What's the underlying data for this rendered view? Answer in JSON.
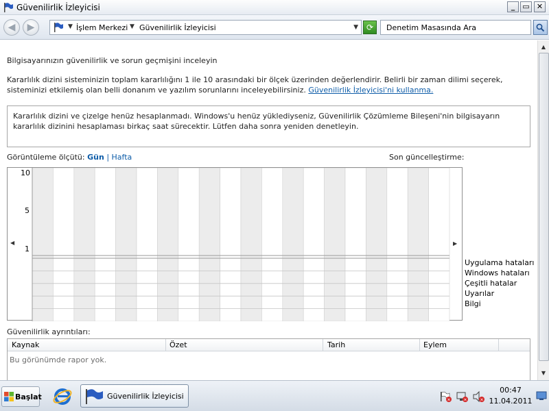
{
  "window": {
    "title": "Güvenilirlik İzleyicisi"
  },
  "nav": {
    "breadcrumbs": [
      "İşlem Merkezi",
      "Güvenilirlik İzleyicisi"
    ],
    "search_placeholder": "Denetim Masasında Ara"
  },
  "page": {
    "heading": "Bilgisayarınızın güvenilirlik ve sorun geçmişini inceleyin",
    "intro": "Kararlılık dizini sisteminizin toplam kararlılığını 1 ile 10 arasındaki bir ölçek üzerinden değerlendirir. Belirli bir zaman dilimi seçerek, sisteminizi etkilemiş olan belli donanım ve yazılım sorunlarını inceleyebilirsiniz.",
    "intro_link": "Güvenilirlik İzleyicisi'ni kullanma.",
    "notice": "Kararlılık dizini ve çizelge henüz hesaplanmadı. Windows'u henüz yüklediyseniz, Güvenilirlik Çözümleme Bileşeni'nin bilgisayarın kararlılık dizinini hesaplaması birkaç saat sürecektir. Lütfen daha sonra yeniden denetleyin.",
    "view_label": "Görüntüleme ölçütü:",
    "view_day": "Gün",
    "view_sep": "|",
    "view_week": "Hafta",
    "last_update": "Son güncelleştirme:",
    "details_label": "Güvenilirlik ayrıntıları:"
  },
  "chart_data": {
    "type": "table",
    "y_ticks": [
      "10",
      "5",
      "1"
    ],
    "rows": [
      "Uygulama hataları",
      "Windows hataları",
      "Çeşitli hatalar",
      "Uyarılar",
      "Bilgi"
    ],
    "columns": 20
  },
  "table": {
    "headers": [
      "Kaynak",
      "Özet",
      "Tarih",
      "Eylem"
    ],
    "empty_text": "Bu görünümde rapor yok."
  },
  "taskbar": {
    "start_label": "Başlat",
    "task_label": "Güvenilirlik İzleyicisi",
    "time": "00:47",
    "date": "11.04.2011"
  }
}
